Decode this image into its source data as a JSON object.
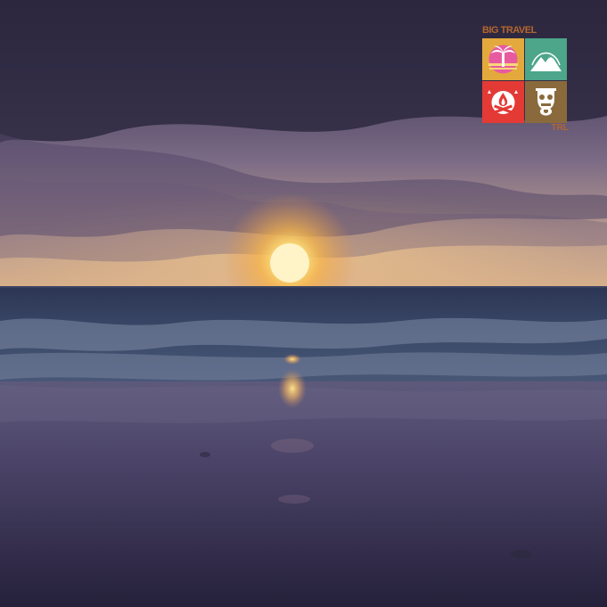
{
  "logo": {
    "brand": "BIG TRAVEL",
    "suffix": "TRL",
    "tiles": [
      {
        "icon": "palm-tree-sunset-icon",
        "color": "#e4a93c"
      },
      {
        "icon": "mountain-icon",
        "color": "#4da58a"
      },
      {
        "icon": "campfire-icon",
        "color": "#e33a35"
      },
      {
        "icon": "tiki-mask-icon",
        "color": "#8a6a3c"
      }
    ]
  }
}
